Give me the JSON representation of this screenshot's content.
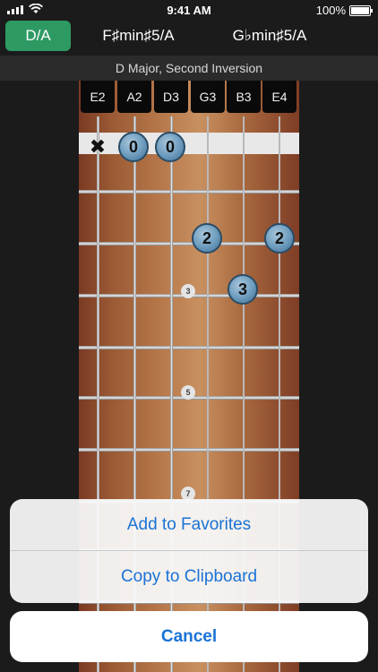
{
  "status": {
    "time": "9:41 AM",
    "battery": "100%"
  },
  "chords": [
    {
      "label": "D/A",
      "active": true
    },
    {
      "label": "F♯min♯5/A",
      "active": false
    },
    {
      "label": "G♭min♯5/A",
      "active": false
    }
  ],
  "subtitle": "D Major, Second Inversion",
  "strings": [
    "E2",
    "A2",
    "D3",
    "G3",
    "B3",
    "E4"
  ],
  "inlays": [
    "3",
    "5",
    "7"
  ],
  "fingering": {
    "muted": [
      0
    ],
    "open_markers": [
      "0",
      "0"
    ],
    "finger_markers": [
      "2",
      "2",
      "3"
    ]
  },
  "action_sheet": {
    "favorites": "Add to Favorites",
    "clipboard": "Copy to Clipboard",
    "cancel": "Cancel"
  },
  "colors": {
    "accent": "#2e9a63",
    "action_blue": "#1a73d6",
    "marker": "#6c9bbd"
  }
}
